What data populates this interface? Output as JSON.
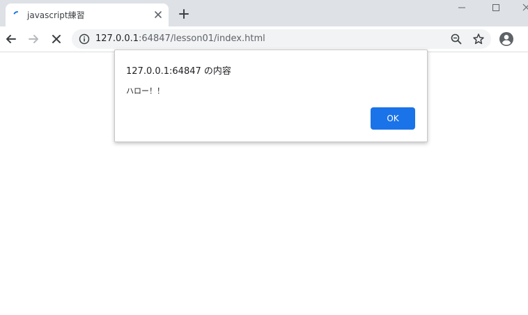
{
  "tab": {
    "title": "javascript練習"
  },
  "address_bar": {
    "host": "127.0.0.1",
    "path": ":64847/lesson01/index.html"
  },
  "dialog": {
    "title": "127.0.0.1:64847 の内容",
    "message": "ハロー！！",
    "ok_label": "OK"
  },
  "colors": {
    "accent": "#1a73e8",
    "titlebar": "#dee1e6",
    "omnibox": "#f1f3f4"
  },
  "icons": {
    "tab_loading": "spinner-icon",
    "tab_close": "close-icon",
    "new_tab": "plus-icon",
    "back": "arrow-left-icon",
    "forward": "arrow-right-icon",
    "stop": "close-icon",
    "site_info": "info-icon",
    "zoom": "zoom-out-icon",
    "bookmark": "star-icon",
    "profile": "account-circle-icon"
  }
}
